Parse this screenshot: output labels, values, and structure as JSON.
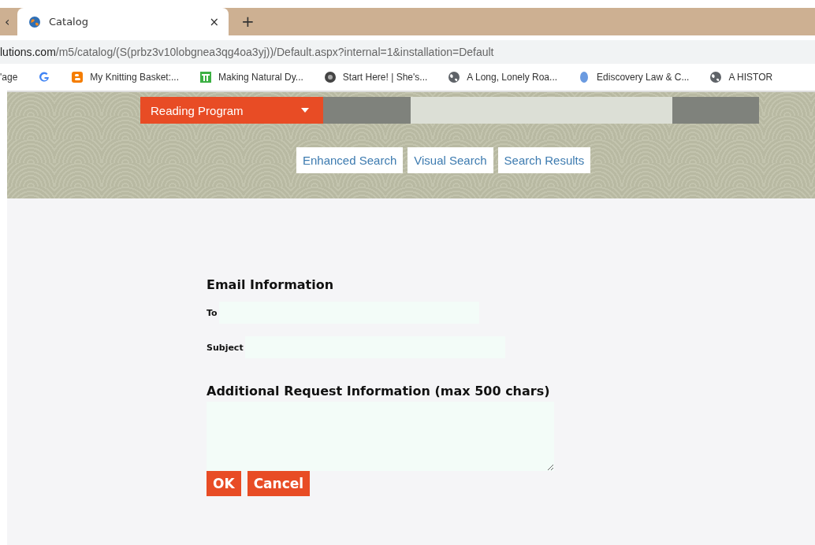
{
  "browser": {
    "tabs": [
      {
        "title": "Catalog",
        "selected": true
      }
    ],
    "close_tab": "×",
    "new_tab": "+",
    "back_edge": "‹",
    "address": {
      "host": "lutions.com",
      "path": "/m5/catalog/(S(prbz3v10lobgnea3qg4oa3yj))/Default.aspx?internal=1&installation=Default"
    },
    "bookmarks": [
      {
        "label": "'age",
        "kind": "none"
      },
      {
        "kind": "google"
      },
      {
        "label": "My Knitting Basket:...",
        "kind": "blogger"
      },
      {
        "label": "Making Natural Dy...",
        "kind": "pt"
      },
      {
        "label": "Start Here! | She's...",
        "kind": "sw"
      },
      {
        "label": "A Long, Lonely Roa...",
        "kind": "globe"
      },
      {
        "label": "Ediscovery Law & C...",
        "kind": "blue"
      },
      {
        "label": "A HISTOR",
        "kind": "globe"
      }
    ]
  },
  "banner": {
    "dropdown": "Reading Program",
    "links": [
      {
        "label": "Enhanced Search"
      },
      {
        "label": "Visual Search"
      },
      {
        "label": "Search Results"
      }
    ]
  },
  "form": {
    "email_heading": "Email Information",
    "to_label": "To",
    "subject_label": "Subject",
    "additional_heading": "Additional Request Information (max 500 chars)",
    "buttons": [
      "OK",
      "Cancel"
    ]
  }
}
